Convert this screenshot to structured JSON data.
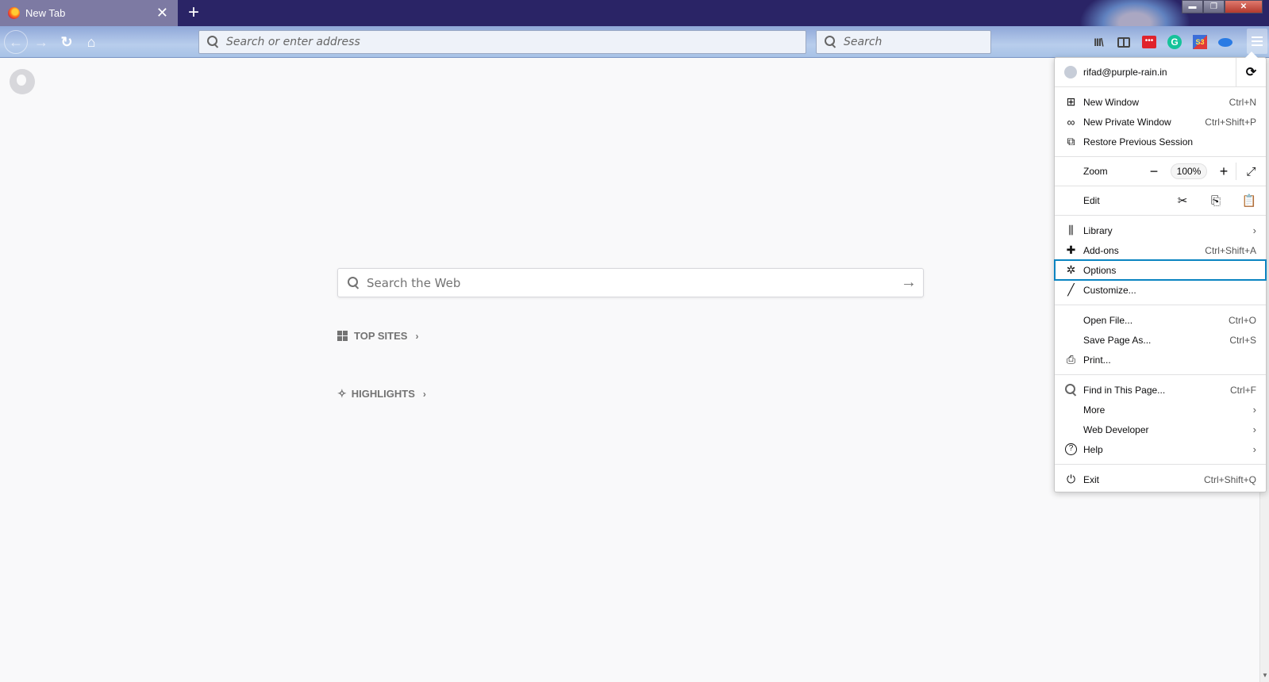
{
  "browser": {
    "tab": {
      "title": "New Tab",
      "close_glyph": "✕"
    },
    "new_tab_glyph": "+",
    "window_controls": {
      "minimize": "▬",
      "restore": "❐",
      "close": "✕"
    },
    "nav": {
      "back_glyph": "←",
      "forward_glyph": "→",
      "reload_glyph": "↻",
      "home_glyph": "⌂"
    },
    "urlbar": {
      "placeholder": "Search or enter address",
      "value": ""
    },
    "searchbar": {
      "placeholder": "Search",
      "value": ""
    },
    "toolbar": {
      "library_glyph": "III\\",
      "pocket_label": "•••",
      "grammarly_label": "G",
      "s3_label": "S3"
    }
  },
  "newtab": {
    "search": {
      "placeholder": "Search the Web",
      "go_glyph": "→"
    },
    "sections": [
      {
        "label": "TOP SITES",
        "chevron": "›"
      },
      {
        "label": "HIGHLIGHTS",
        "chevron": "›"
      }
    ]
  },
  "menu": {
    "account": {
      "email": "rifad@purple-rain.in",
      "sync_glyph": "⟳"
    },
    "group1": [
      {
        "label": "New Window",
        "shortcut": "Ctrl+N",
        "icon": "new-window-icon",
        "glyph": "⊞"
      },
      {
        "label": "New Private Window",
        "shortcut": "Ctrl+Shift+P",
        "icon": "private-mask-icon",
        "glyph": "∞"
      },
      {
        "label": "Restore Previous Session",
        "shortcut": "",
        "icon": "restore-session-icon",
        "glyph": "⧉"
      }
    ],
    "zoom": {
      "label": "Zoom",
      "minus": "−",
      "value": "100%",
      "plus": "+",
      "fullscreen": "⤢"
    },
    "edit": {
      "label": "Edit",
      "cut": "✂",
      "copy": "⎘",
      "paste": "📋"
    },
    "group2": [
      {
        "label": "Library",
        "shortcut": "",
        "arrow": "›",
        "icon": "library-icon",
        "glyph": "⫼"
      },
      {
        "label": "Add-ons",
        "shortcut": "Ctrl+Shift+A",
        "arrow": "",
        "icon": "puzzle-icon",
        "glyph": "✚"
      },
      {
        "label": "Options",
        "shortcut": "",
        "arrow": "",
        "icon": "gear-icon",
        "glyph": "✲",
        "highlighted": true
      },
      {
        "label": "Customize...",
        "shortcut": "",
        "arrow": "",
        "icon": "paintbrush-icon",
        "glyph": "╱"
      }
    ],
    "group3": [
      {
        "label": "Open File...",
        "shortcut": "Ctrl+O",
        "arrow": ""
      },
      {
        "label": "Save Page As...",
        "shortcut": "Ctrl+S",
        "arrow": ""
      },
      {
        "label": "Print...",
        "shortcut": "",
        "arrow": "",
        "icon": "printer-icon",
        "glyph": "⎙"
      }
    ],
    "group4": [
      {
        "label": "Find in This Page...",
        "shortcut": "Ctrl+F",
        "arrow": "",
        "icon": "search-icon",
        "glyph": "🔍"
      },
      {
        "label": "More",
        "shortcut": "",
        "arrow": "›"
      },
      {
        "label": "Web Developer",
        "shortcut": "",
        "arrow": "›"
      },
      {
        "label": "Help",
        "shortcut": "",
        "arrow": "›",
        "icon": "help-icon",
        "glyph": "?"
      }
    ],
    "exit": {
      "label": "Exit",
      "shortcut": "Ctrl+Shift+Q",
      "glyph": "⏻"
    }
  },
  "colors": {
    "highlight": "#0a84c1",
    "tabstrip": "#2a2466"
  }
}
